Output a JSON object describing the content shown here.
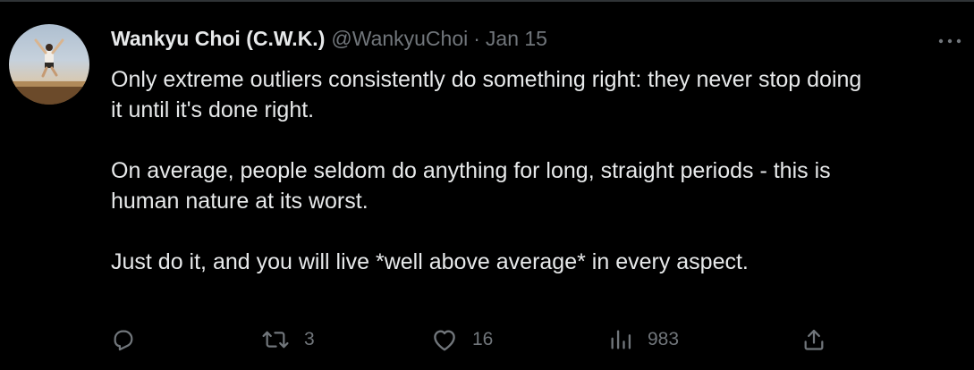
{
  "author": {
    "display_name": "Wankyu Choi (C.W.K.)",
    "handle": "@WankyuChoi",
    "separator": "·",
    "date": "Jan 15"
  },
  "tweet": {
    "paragraphs": [
      {
        "line1": "Only extreme outliers consistently do something right:  they never stop doing",
        "line2": "it until it's done right."
      },
      {
        "line1": "On average, people seldom do anything for long, straight periods - this is",
        "line2": "human nature at its worst."
      },
      {
        "line1": "Just do it, and you will live *well above average* in every aspect."
      }
    ]
  },
  "actions": {
    "reply": {
      "icon": "reply-icon"
    },
    "retweet": {
      "icon": "retweet-icon",
      "count": "3"
    },
    "like": {
      "icon": "heart-icon",
      "count": "16"
    },
    "views": {
      "icon": "views-chart-icon",
      "count": "983"
    },
    "share": {
      "icon": "share-icon"
    }
  },
  "icons": {
    "more": "more-options-icon"
  },
  "colors": {
    "background": "#000000",
    "text_primary": "#e7e9ea",
    "text_secondary": "#71767b",
    "divider": "#2f3336"
  }
}
